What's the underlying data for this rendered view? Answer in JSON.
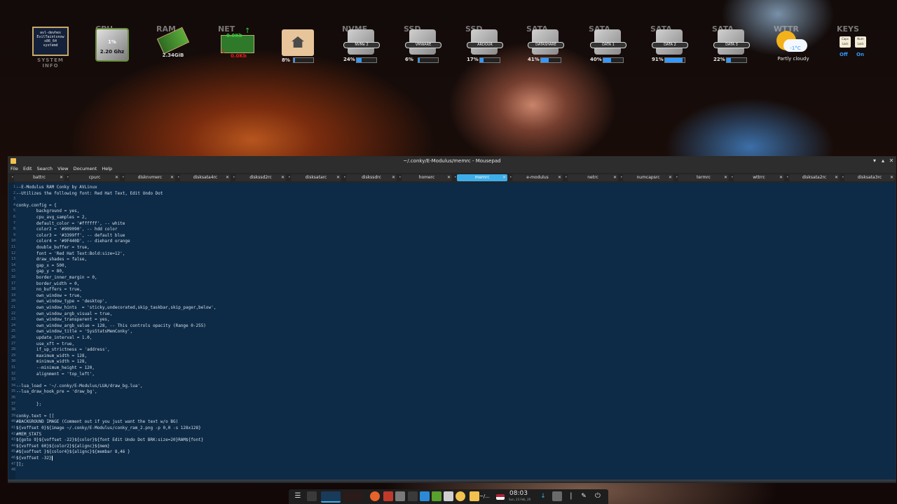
{
  "conky": {
    "system_info": {
      "lines": [
        "avl-devhex",
        "EvilTaintsnow",
        "x86_64",
        "systemd"
      ],
      "caption": "SYSTEM INFO"
    },
    "cpu": {
      "title": "CPU",
      "percent": "1%",
      "freq": "2.20 Ghz"
    },
    "ram": {
      "title": "RAM",
      "value": "2.34GiB"
    },
    "net": {
      "title": "NET",
      "up": "0.0Kb",
      "down": "0.0Kb"
    },
    "home": {
      "percent": "8%",
      "fill": 0.08
    },
    "disks": [
      {
        "title": "NVME",
        "label": "NVMe 2",
        "percent": "24%",
        "fill": 0.24
      },
      {
        "title": "SSD",
        "label": "VMWARE",
        "percent": "6%",
        "fill": 0.06
      },
      {
        "title": "SSD",
        "label": "ARDOUR",
        "percent": "17%",
        "fill": 0.17
      },
      {
        "title": "SATA",
        "label": "DATASHARE",
        "percent": "41%",
        "fill": 0.41
      },
      {
        "title": "SATA",
        "label": "DATA 1",
        "percent": "40%",
        "fill": 0.4
      },
      {
        "title": "SATA",
        "label": "DATA 2",
        "percent": "91%",
        "fill": 0.91
      },
      {
        "title": "SATA",
        "label": "DATA 3",
        "percent": "22%",
        "fill": 0.22
      }
    ],
    "wttr": {
      "title": "WTTR",
      "temp": "-1°C",
      "condition": "Partly cloudy"
    },
    "keys": {
      "title": "KEYS",
      "caps": "Caps Lock",
      "num": "Num Lock",
      "caps_state": "Off",
      "num_state": "On"
    }
  },
  "window": {
    "title": "~/.conky/E-Modulus/memrc - Mousepad",
    "menu": [
      "File",
      "Edit",
      "Search",
      "View",
      "Document",
      "Help"
    ],
    "tabs": [
      "battrc",
      "cpurc",
      "disknvmerc",
      "disksata4rc",
      "diskssd2rc",
      "disksatarc",
      "diskssdrc",
      "homerc",
      "memrc",
      "e-modulus",
      "netrc",
      "numcapsrc",
      "termrc",
      "wttrrc",
      "disksata2rc",
      "disksata3rc"
    ],
    "active_tab": 8,
    "lines": [
      "--E-Modulus RAM Conky by AVLinux",
      "--Utilizes the following font: Red Hat Text, Edit Undo Dot",
      "",
      "conky.config = {",
      "        background = yes,",
      "        cpu_avg_samples = 2,",
      "        default_color = '#ffffff', -- white",
      "        color2 = '#909090', -- hdd color",
      "        color3 = '#3399ff', -- default blue",
      "        color4 = '#9F440D', -- diehard orange",
      "        double_buffer = true,",
      "        font = 'Red Hat Text:Bold:size=12',",
      "        draw_shades = false,",
      "        gap_x = 500,",
      "        gap_y = 80,",
      "        border_inner_margin = 0,",
      "        border_width = 0,",
      "        no_buffers = true,",
      "        own_window = true,",
      "        own_window_type = 'desktop',",
      "        own_window_hints  = 'sticky,undecorated,skip_taskbar,skip_pager,below',",
      "        own_window_argb_visual = true,",
      "        own_window_transparent = yes,",
      "        own_window_argb_value = 128, -- This controls opacity (Range 0-255)",
      "        own_window_title = 'SysStatsMemConky',",
      "        update_interval = 1.0,",
      "        use_xft = true,",
      "        if_up_strictness = 'address',",
      "        maximum_width = 128,",
      "        minimum_width = 128,",
      "        --minimum_height = 120,",
      "        alignment = 'top_left',",
      "",
      "--lua_load = '~/.conky/E-Modulus/LUA/draw_bg.lua',",
      "--lua_draw_hook_pre = 'draw_bg',",
      "",
      "        };",
      "",
      "conky.text = [[",
      "#BACKGROUND IMAGE (Comment out if you just want the text w/o BG)",
      "${voffset 0}${image ~/.conky/E-Modulus/conky_ram_2.png -p 0,0 -s 128x128}",
      "#MEM_STATS",
      "${goto 9}${voffset -22}${color}${font Edit Undo Dot BRK:size=20}RAM${font}",
      "${voffset 60}${color2}${alignc}${mem}",
      "#${voffset }${color4}${alignc}${membar 8,46 }",
      "${voffset -32}",
      "]];",
      ""
    ]
  },
  "taskbar": {
    "clock": "08:03",
    "date": "Sun, 23 Feb, 20",
    "term_label": "~/..."
  }
}
